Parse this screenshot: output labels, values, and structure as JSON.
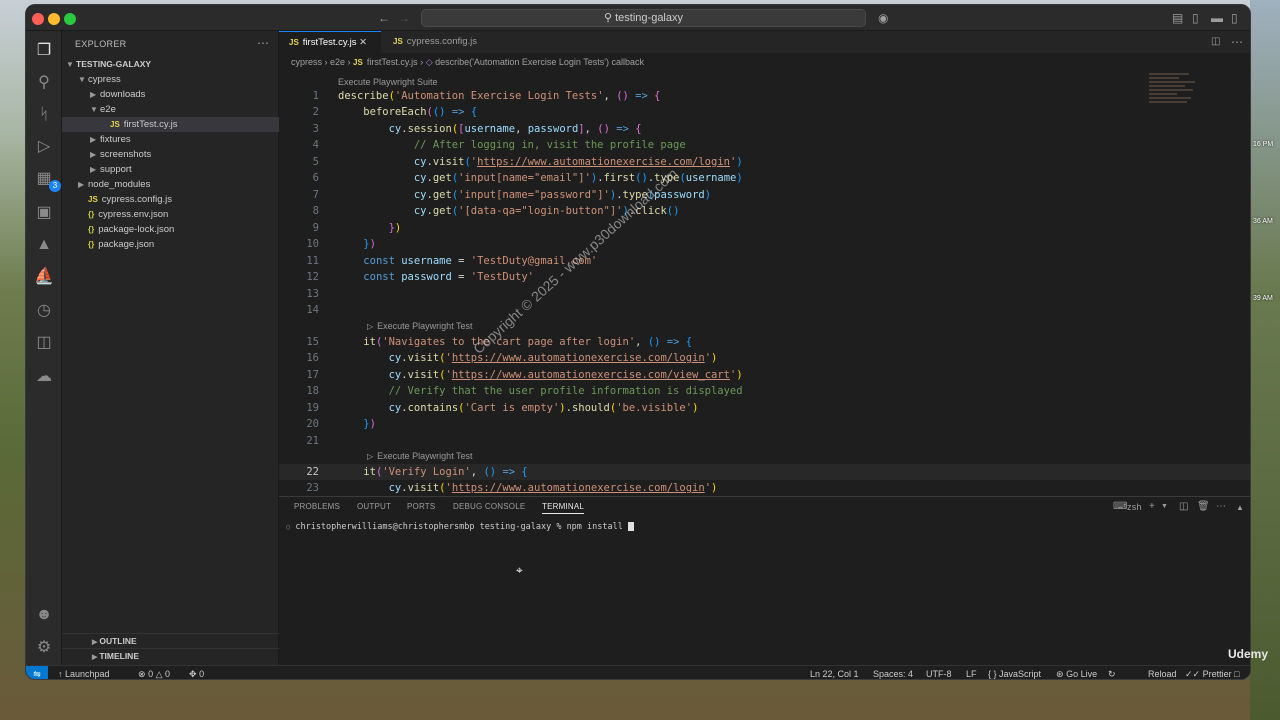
{
  "window": {
    "title": "testing-galaxy"
  },
  "explorer": {
    "title": "EXPLORER",
    "project": "TESTING-GALAXY",
    "items": [
      {
        "label": "cypress",
        "kind": "folder-open"
      },
      {
        "label": "downloads",
        "kind": "folder"
      },
      {
        "label": "e2e",
        "kind": "folder-open"
      },
      {
        "label": "firstTest.cy.js",
        "kind": "js"
      },
      {
        "label": "fixtures",
        "kind": "folder"
      },
      {
        "label": "screenshots",
        "kind": "folder"
      },
      {
        "label": "support",
        "kind": "folder"
      },
      {
        "label": "node_modules",
        "kind": "folder"
      },
      {
        "label": "cypress.config.js",
        "kind": "js"
      },
      {
        "label": "cypress.env.json",
        "kind": "json"
      },
      {
        "label": "package-lock.json",
        "kind": "json"
      },
      {
        "label": "package.json",
        "kind": "json"
      }
    ],
    "outline": "OUTLINE",
    "timeline": "TIMELINE"
  },
  "tabs": [
    {
      "label": "firstTest.cy.js",
      "active": true
    },
    {
      "label": "cypress.config.js",
      "active": false
    }
  ],
  "breadcrumb": [
    "cypress",
    "e2e",
    "firstTest.cy.js",
    "describe('Automation Exercise Login Tests') callback"
  ],
  "codelens": {
    "suite": "Execute Playwright Suite",
    "test": "Execute Playwright Test"
  },
  "code": {
    "l1": "describe('Automation Exercise Login Tests', () => {",
    "l2": "    beforeEach(() => {",
    "l3": "        cy.session([username, password], () => {",
    "l4": "            // After logging in, visit the profile page",
    "l5": "            cy.visit('https://www.automationexercise.com/login')",
    "l6": "            cy.get('input[name=\"email\"]').first().type(username)",
    "l7": "            cy.get('input[name=\"password\"]').type(password)",
    "l8": "            cy.get('[data-qa=\"login-button\"]').click()",
    "l9": "        })",
    "l10": "    })",
    "l11": "    const username = 'TestDuty@gmail.com'",
    "l12": "    const password = 'TestDuty'",
    "l13": "",
    "l14": "",
    "l15": "    it('Navigates to the cart page after login', () => {",
    "l16": "        cy.visit('https://www.automationexercise.com/login')",
    "l17": "        cy.visit('https://www.automationexercise.com/view_cart')",
    "l18": "        // Verify that the user profile information is displayed",
    "l19": "        cy.contains('Cart is empty').should('be.visible')",
    "l20": "    })",
    "l21": "",
    "l22": "    it('Verify Login', () => {",
    "l23": "        cy.visit('https://www.automationexercise.com/login')"
  },
  "panel": {
    "tabs": [
      "PROBLEMS",
      "OUTPUT",
      "PORTS",
      "DEBUG CONSOLE",
      "TERMINAL"
    ],
    "shell": "zsh",
    "prompt": "christopherwilliams@christophersmbp testing-galaxy % npm install"
  },
  "status": {
    "branch": "Launchpad",
    "errors": "0",
    "warnings": "0",
    "ports": "0",
    "position": "Ln 22, Col 1",
    "spaces": "Spaces: 4",
    "encoding": "UTF-8",
    "eol": "LF",
    "language": "JavaScript",
    "golive": "Go Live",
    "reload": "Reload",
    "prettier": "Prettier"
  },
  "overlay": {
    "watermark": "Copyright © 2025 - www.p30download.com",
    "brand": "Udemy"
  },
  "desktop_clock": [
    "16 PM",
    "36 AM",
    "39 AM"
  ]
}
